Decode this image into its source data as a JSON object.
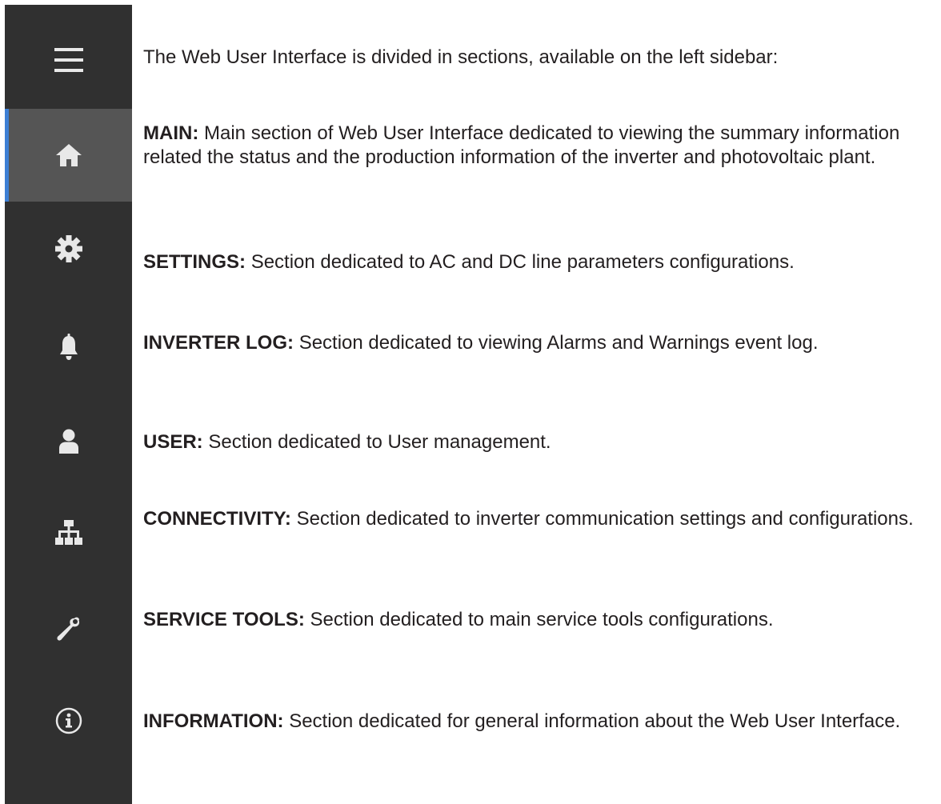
{
  "intro": "The Web User Interface is divided in sections, available on the left sidebar:",
  "colors": {
    "sidebar_bg": "#303030",
    "active_bg": "#555555",
    "active_indicator": "#3d7fd4",
    "icon": "#e8e8e8",
    "text": "#231f20"
  },
  "sidebar": {
    "menu_icon": "hamburger-menu-icon",
    "active_item": "main",
    "items": [
      {
        "id": "main",
        "icon": "home-icon"
      },
      {
        "id": "settings",
        "icon": "gear-icon"
      },
      {
        "id": "inverter-log",
        "icon": "bell-icon"
      },
      {
        "id": "user",
        "icon": "user-icon"
      },
      {
        "id": "connectivity",
        "icon": "network-icon"
      },
      {
        "id": "service-tools",
        "icon": "wrench-icon"
      },
      {
        "id": "information",
        "icon": "info-icon"
      }
    ]
  },
  "sections": [
    {
      "name": "MAIN:",
      "description": "Main section of Web User Interface dedicated to viewing the summary information related the status and the production information of the inverter and photovoltaic plant."
    },
    {
      "name": "SETTINGS:",
      "description": "Section dedicated to AC and DC line parameters configurations."
    },
    {
      "name": "INVERTER LOG:",
      "description": "Section dedicated to viewing Alarms and Warnings event log."
    },
    {
      "name": "USER:",
      "description": "Section dedicated to User management."
    },
    {
      "name": "CONNECTIVITY:",
      "description": "Section dedicated to inverter communication settings and configurations."
    },
    {
      "name": "SERVICE TOOLS:",
      "description": "Section dedicated to main service tools configurations."
    },
    {
      "name": "INFORMATION:",
      "description": "Section dedicated for general information about the Web User Interface."
    }
  ]
}
